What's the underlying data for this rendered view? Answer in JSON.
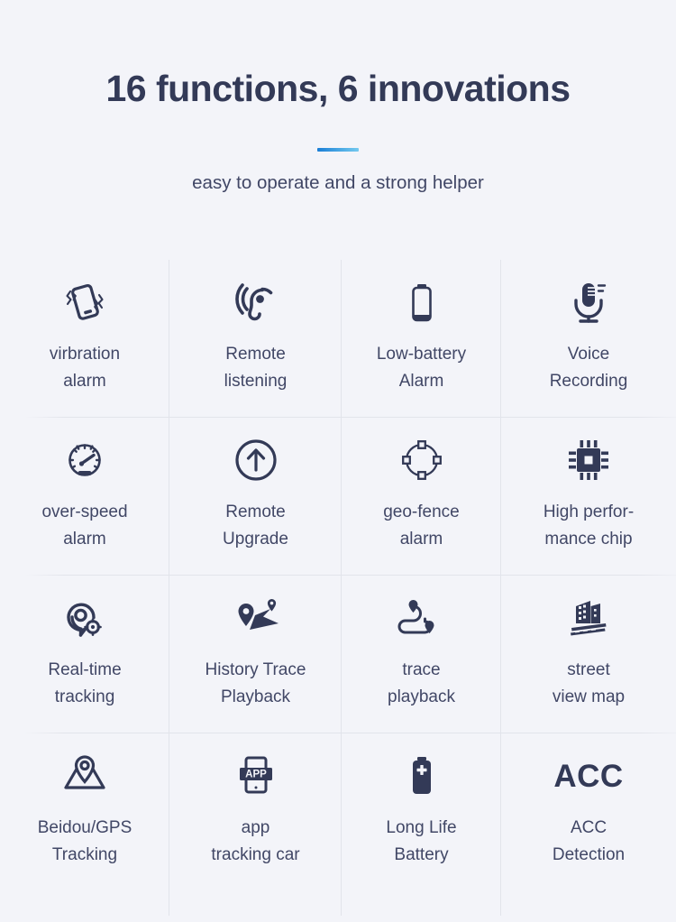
{
  "header": {
    "headline": "16 functions, 6 innovations",
    "subhead": "easy to operate and a strong helper",
    "accent_color_start": "#1a7ed6",
    "accent_color_end": "#74c9ef"
  },
  "theme": {
    "background": "#f3f4f9",
    "icon_color": "#333a57",
    "text_color": "#414766",
    "divider_color": "#e2e4eb"
  },
  "features": [
    {
      "icon": "vibrating-phone-icon",
      "label": "virbration\nalarm"
    },
    {
      "icon": "ear-listening-icon",
      "label": "Remote\nlistening"
    },
    {
      "icon": "low-battery-icon",
      "label": "Low-battery\nAlarm"
    },
    {
      "icon": "microphone-icon",
      "label": "Voice\nRecording"
    },
    {
      "icon": "speedometer-icon",
      "label": "over-speed\nalarm"
    },
    {
      "icon": "circle-up-arrow-icon",
      "label": "Remote\nUpgrade"
    },
    {
      "icon": "geo-fence-circle-icon",
      "label": "geo-fence\nalarm"
    },
    {
      "icon": "cpu-chip-icon",
      "label": "High perfor-\nmance chip"
    },
    {
      "icon": "location-target-icon",
      "label": "Real-time\ntracking"
    },
    {
      "icon": "map-route-pins-icon",
      "label": "History Trace\nPlayback"
    },
    {
      "icon": "route-trace-icon",
      "label": "trace\nplayback"
    },
    {
      "icon": "buildings-street-icon",
      "label": "street\nview map"
    },
    {
      "icon": "map-pin-fold-icon",
      "label": "Beidou/GPS\nTracking"
    },
    {
      "icon": "phone-app-icon",
      "label": "app\ntracking car",
      "glyph_text": "APP"
    },
    {
      "icon": "full-battery-plus-icon",
      "label": "Long Life\nBattery"
    },
    {
      "icon": "acc-text-icon",
      "label": "ACC\nDetection",
      "glyph_text": "ACC"
    }
  ]
}
